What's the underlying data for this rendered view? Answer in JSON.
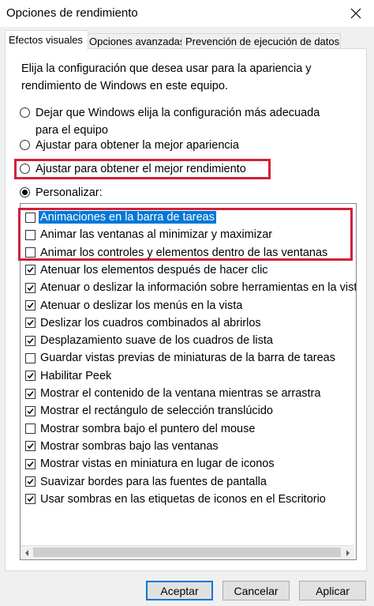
{
  "window": {
    "title": "Opciones de rendimiento",
    "close_icon": "close-icon"
  },
  "tabs": [
    {
      "label": "Efectos visuales",
      "active": true
    },
    {
      "label": "Opciones avanzadas",
      "active": false
    },
    {
      "label": "Prevención de ejecución de datos",
      "active": false
    }
  ],
  "description": "Elija la configuración que desea usar para la apariencia y rendimiento de Windows en este equipo.",
  "radios": [
    {
      "label": "Dejar que Windows elija la configuración más adecuada para el equipo",
      "checked": false
    },
    {
      "label": "Ajustar para obtener la mejor apariencia",
      "checked": false
    },
    {
      "label": "Ajustar para obtener el mejor rendimiento",
      "checked": false
    },
    {
      "label": "Personalizar:",
      "checked": true
    }
  ],
  "effects": [
    {
      "label": "Animaciones en la barra de tareas",
      "checked": false,
      "selected": true
    },
    {
      "label": "Animar las ventanas al minimizar y maximizar",
      "checked": false
    },
    {
      "label": "Animar los controles y elementos dentro de las ventanas",
      "checked": false
    },
    {
      "label": "Atenuar los elementos después de hacer clic",
      "checked": true
    },
    {
      "label": "Atenuar o deslizar la información sobre herramientas en la vista",
      "checked": true
    },
    {
      "label": "Atenuar o deslizar los menús en la vista",
      "checked": true
    },
    {
      "label": "Deslizar los cuadros combinados al abrirlos",
      "checked": true
    },
    {
      "label": "Desplazamiento suave de los cuadros de lista",
      "checked": true
    },
    {
      "label": "Guardar vistas previas de miniaturas de la barra de tareas",
      "checked": false
    },
    {
      "label": "Habilitar Peek",
      "checked": true
    },
    {
      "label": "Mostrar el contenido de la ventana mientras se arrastra",
      "checked": true
    },
    {
      "label": "Mostrar el rectángulo de selección translúcido",
      "checked": true
    },
    {
      "label": "Mostrar sombra bajo el puntero del mouse",
      "checked": false
    },
    {
      "label": "Mostrar sombras bajo las ventanas",
      "checked": true
    },
    {
      "label": "Mostrar vistas en miniatura en lugar de iconos",
      "checked": true
    },
    {
      "label": "Suavizar bordes para las fuentes de pantalla",
      "checked": true
    },
    {
      "label": "Usar sombras en las etiquetas de iconos en el Escritorio",
      "checked": true
    }
  ],
  "buttons": {
    "accept": "Aceptar",
    "cancel": "Cancelar",
    "apply": "Aplicar"
  },
  "colors": {
    "highlight": "#d0213a",
    "selection": "#0078d7"
  }
}
